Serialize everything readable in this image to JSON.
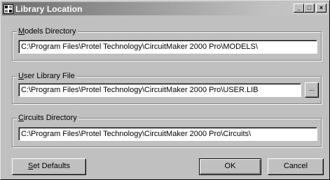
{
  "window": {
    "title": "Library Location",
    "minimize_label": "_",
    "maximize_label": "□",
    "close_label": "×"
  },
  "models": {
    "label_prefix": "",
    "label_accel": "M",
    "label_rest": "odels Directory",
    "value": "C:\\Program Files\\Protel Technology\\CircuitMaker 2000 Pro\\MODELS\\"
  },
  "user_library": {
    "label_accel": "U",
    "label_rest": "ser Library File",
    "value": "C:\\Program Files\\Protel Technology\\CircuitMaker 2000 Pro\\USER.LIB",
    "browse_label": "..."
  },
  "circuits": {
    "label_accel": "C",
    "label_rest": "ircuits Directory",
    "value": "C:\\Program Files\\Protel Technology\\CircuitMaker 2000 Pro\\Circuits\\"
  },
  "buttons": {
    "set_defaults_accel": "S",
    "set_defaults_rest": "et Defaults",
    "ok": "OK",
    "cancel": "Cancel"
  },
  "colors": {
    "titlebar_start": "#6e6e6e",
    "face": "#c0c0c0"
  },
  "icons": {
    "app": "library-window-icon",
    "browse": "ellipsis-browse-icon"
  }
}
